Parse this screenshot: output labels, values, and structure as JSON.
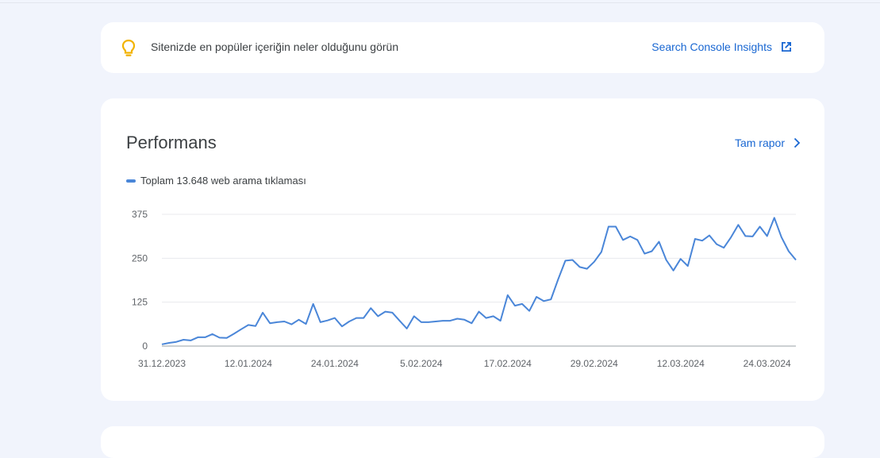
{
  "insight": {
    "message": "Sitenizde en popüler içeriğin neler olduğunu görün",
    "link_label": "Search Console Insights",
    "icon": "lightbulb-icon"
  },
  "performance": {
    "title": "Performans",
    "full_report_label": "Tam rapor",
    "legend_label": "Toplam 13.648 web arama tıklaması"
  },
  "colors": {
    "accent": "#1967d2",
    "series": "#4a86d8",
    "bulb": "#f2b300"
  },
  "chart_data": {
    "type": "line",
    "title": "",
    "xlabel": "",
    "ylabel": "",
    "ylim": [
      0,
      375
    ],
    "yticks": [
      0,
      125,
      250,
      375
    ],
    "ytick_labels": [
      "0",
      "125",
      "250",
      "375"
    ],
    "xtick_labels": [
      "31.12.2023",
      "12.01.2024",
      "24.01.2024",
      "5.02.2024",
      "17.02.2024",
      "29.02.2024",
      "12.03.2024",
      "24.03.2024"
    ],
    "xtick_index": [
      0,
      12,
      24,
      36,
      48,
      60,
      72,
      84
    ],
    "grid": true,
    "legend": "top-left",
    "series": [
      {
        "name": "Toplam 13.648 web arama tıklaması",
        "values": [
          5,
          9,
          12,
          18,
          16,
          25,
          25,
          34,
          24,
          23,
          35,
          48,
          60,
          57,
          95,
          65,
          68,
          70,
          62,
          75,
          63,
          120,
          68,
          73,
          80,
          56,
          70,
          80,
          80,
          108,
          85,
          98,
          95,
          72,
          50,
          85,
          68,
          68,
          70,
          72,
          72,
          78,
          75,
          65,
          98,
          80,
          85,
          72,
          145,
          115,
          120,
          100,
          140,
          128,
          133,
          190,
          243,
          245,
          225,
          220,
          240,
          268,
          340,
          340,
          302,
          312,
          302,
          263,
          270,
          297,
          245,
          215,
          248,
          228,
          305,
          300,
          315,
          290,
          280,
          310,
          345,
          313,
          312,
          340,
          313,
          365,
          310,
          270,
          245
        ]
      }
    ]
  }
}
